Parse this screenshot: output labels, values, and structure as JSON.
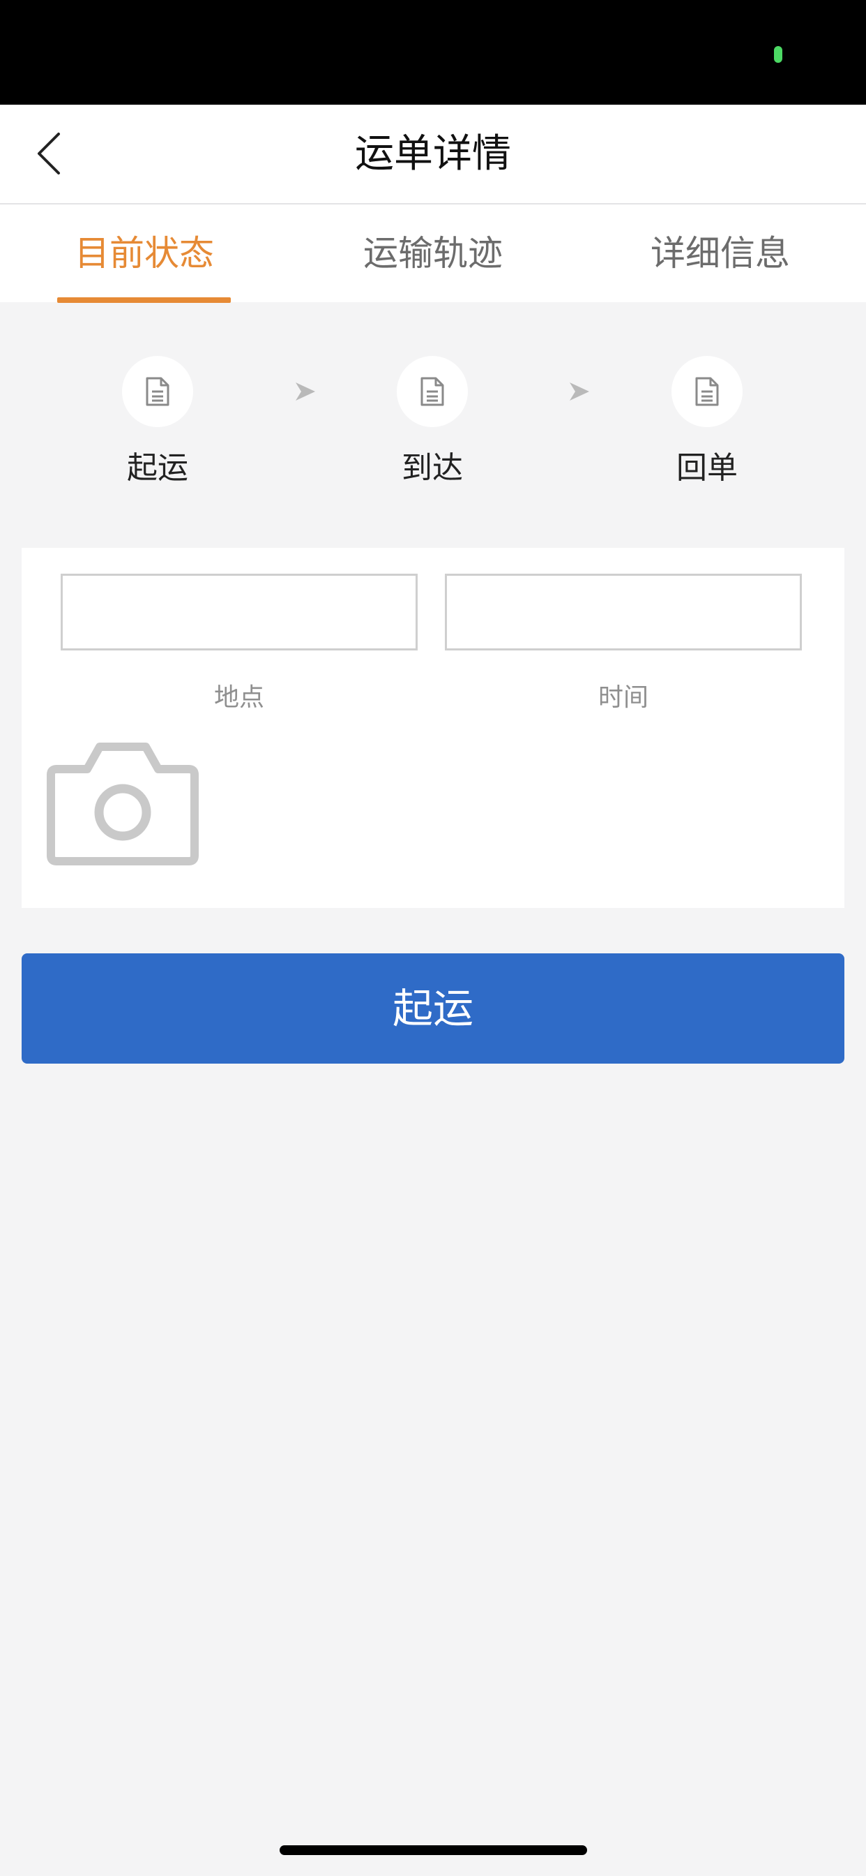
{
  "nav": {
    "title": "运单详情",
    "back_icon": "chevron-left-icon"
  },
  "tabs": [
    {
      "label": "目前状态",
      "active": true
    },
    {
      "label": "运输轨迹",
      "active": false
    },
    {
      "label": "详细信息",
      "active": false
    }
  ],
  "steps": [
    {
      "label": "起运",
      "icon": "document-icon"
    },
    {
      "label": "到达",
      "icon": "document-icon"
    },
    {
      "label": "回单",
      "icon": "document-icon"
    }
  ],
  "form": {
    "location": {
      "label": "地点",
      "value": ""
    },
    "time": {
      "label": "时间",
      "value": ""
    },
    "photo_icon": "camera-icon"
  },
  "action": {
    "label": "起运"
  },
  "colors": {
    "accent": "#e68a35",
    "primary_button": "#2f6bc7",
    "background": "#f4f4f5",
    "status_indicator": "#4cd964"
  }
}
